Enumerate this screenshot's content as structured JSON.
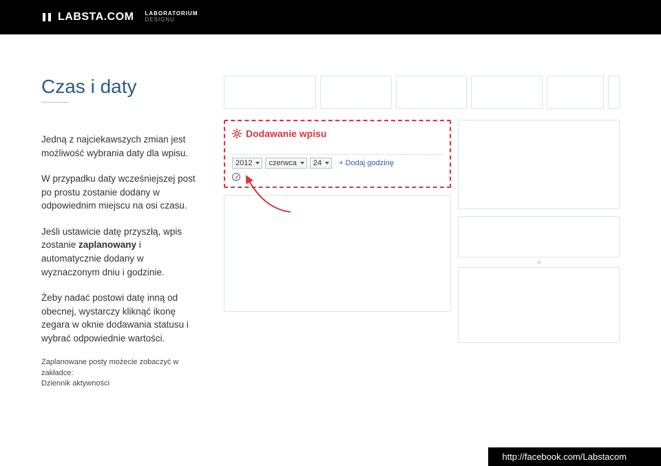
{
  "header": {
    "brand": "LABSTA.COM",
    "subtitle_line1": "LABORATORIUM",
    "subtitle_line2": "DESIGNU"
  },
  "page": {
    "title": "Czas i daty",
    "paragraphs": {
      "p1": "Jedną z najciekawszych zmian jest możliwość wybrania daty dla wpisu.",
      "p2": "W przypadku daty wcześniejszej post po prostu zostanie dodany w odpowiednim miejscu na osi czasu.",
      "p3_before": "Jeśli ustawicie datę przyszłą, wpis zostanie ",
      "p3_bold": "zaplanowany",
      "p3_after": " i automatycznie dodany w wyznaczonym dniu i godzinie.",
      "p4": "Żeby nadać postowi datę inną od obecnej, wystarczy kliknąć ikonę zegara w oknie dodawania statusu i wybrać odpowiednie wartości."
    },
    "note_line1": "Zaplanowane posty możecie zobaczyć w zakładce:",
    "note_line2": "Dziennik aktywności"
  },
  "add_post": {
    "title": "Dodawanie wpisu",
    "year": "2012",
    "month": "czerwca",
    "day": "24",
    "add_time": "+ Dodaj godzinę"
  },
  "footer": {
    "url": "http://facebook.com/Labstacom"
  }
}
